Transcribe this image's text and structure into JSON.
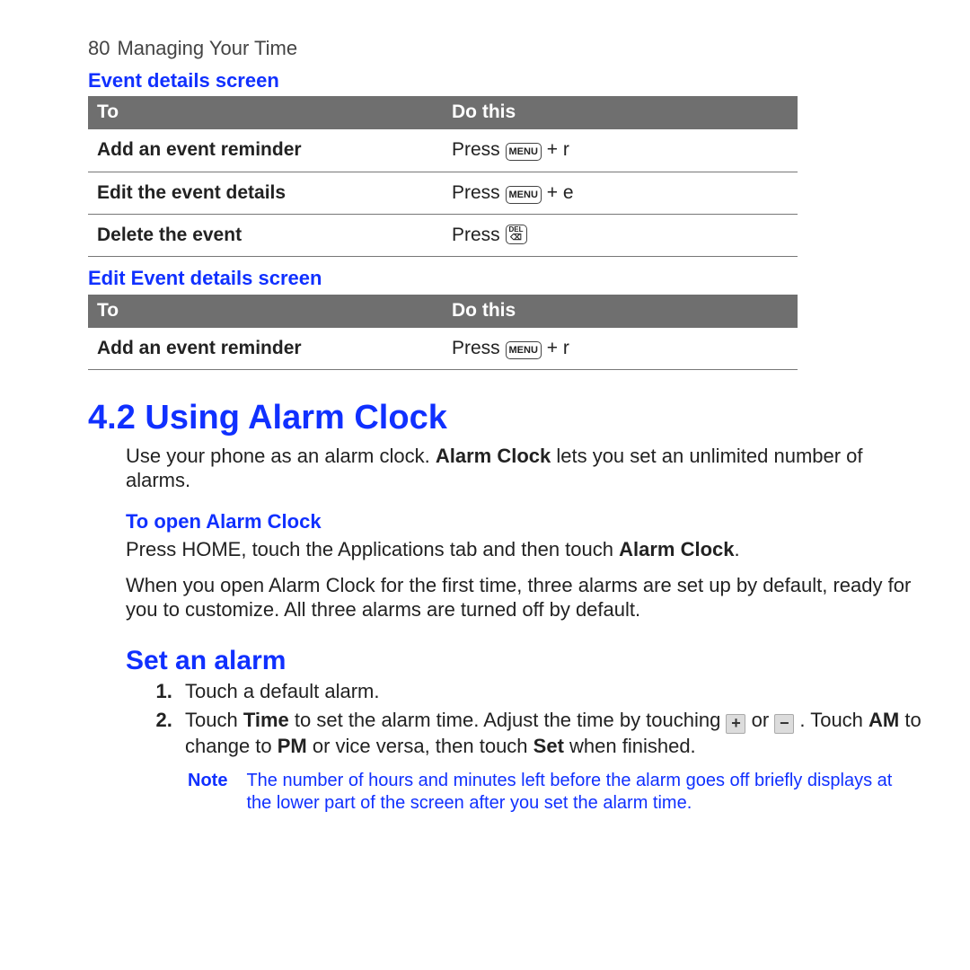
{
  "header": {
    "page_number": "80",
    "chapter": "Managing Your Time"
  },
  "section1": {
    "title": "Event details screen",
    "th_to": "To",
    "th_do": "Do this",
    "rows": [
      {
        "to": "Add an event reminder",
        "press": "Press ",
        "key": "MENU",
        "suffix": " + r"
      },
      {
        "to": "Edit the event details",
        "press": "Press ",
        "key": "MENU",
        "suffix": " + e"
      },
      {
        "to": "Delete the event",
        "press": "Press ",
        "key": "DEL",
        "suffix": ""
      }
    ]
  },
  "section2": {
    "title": "Edit Event details screen",
    "th_to": "To",
    "th_do": "Do this",
    "rows": [
      {
        "to": "Add an event reminder",
        "press": "Press ",
        "key": "MENU",
        "suffix": " + r"
      }
    ]
  },
  "alarm": {
    "heading": "4.2  Using Alarm Clock",
    "intro_a": "Use your phone as an alarm clock. ",
    "intro_b": "Alarm Clock",
    "intro_c": " lets you set an unlimited number of alarms.",
    "open_title": "To open Alarm Clock",
    "open_a": "Press HOME, touch the Applications tab and then touch ",
    "open_b": "Alarm Clock",
    "open_c": ".",
    "open_p2": "When you open Alarm Clock for the first time, three alarms are set up by default, ready for you to customize. All three alarms are turned off by default.",
    "set_heading": "Set an alarm",
    "step1": "Touch a default alarm.",
    "step2_a": "Touch ",
    "step2_b": "Time",
    "step2_c": " to set the alarm time. Adjust the time by touching ",
    "step2_d": " or ",
    "step2_e": " . Touch ",
    "step2_f": "AM",
    "step2_g": " to change to ",
    "step2_h": "PM",
    "step2_i": " or vice versa, then touch ",
    "step2_j": "Set",
    "step2_k": " when finished.",
    "note_label": "Note",
    "note_text": "The number of hours and minutes left before the alarm goes off briefly displays at the lower part of the screen after you set the alarm time."
  }
}
